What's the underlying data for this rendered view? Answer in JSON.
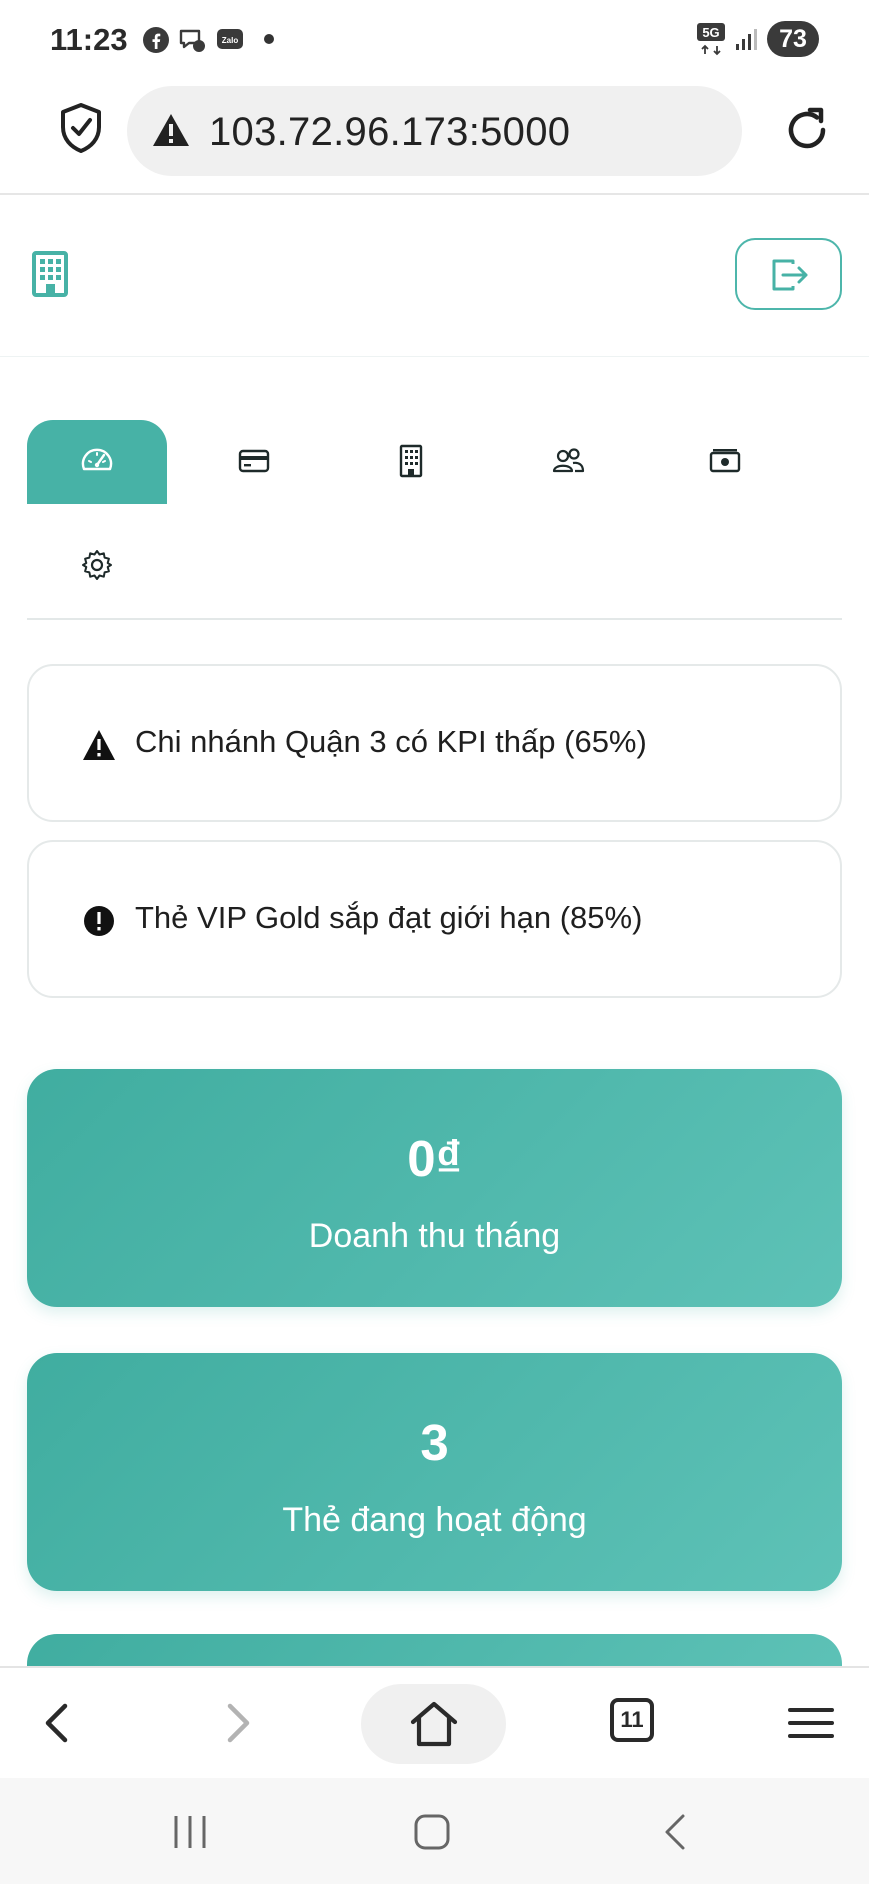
{
  "status_bar": {
    "time": "11:23",
    "network": "5G",
    "battery": "73",
    "notification_icons": [
      "facebook-icon",
      "messenger-icon",
      "zalo-icon"
    ]
  },
  "browser": {
    "url": "103.72.96.173:5000",
    "tab_count": "11"
  },
  "app": {
    "accent_color": "#47b2a6",
    "tabs": [
      {
        "icon": "dashboard-icon",
        "active": true
      },
      {
        "icon": "card-icon",
        "active": false
      },
      {
        "icon": "building-icon",
        "active": false
      },
      {
        "icon": "users-icon",
        "active": false
      },
      {
        "icon": "cash-icon",
        "active": false
      },
      {
        "icon": "gear-icon",
        "active": false
      }
    ],
    "alerts": [
      {
        "icon": "warning-icon",
        "text": "Chi nhánh Quận 3 có KPI thấp (65%)"
      },
      {
        "icon": "exclamation-icon",
        "text": "Thẻ VIP Gold sắp đạt giới hạn (85%)"
      }
    ],
    "stats": [
      {
        "value": "0₫",
        "label": "Doanh thu tháng"
      },
      {
        "value": "3",
        "label": "Thẻ đang hoạt động"
      }
    ]
  }
}
